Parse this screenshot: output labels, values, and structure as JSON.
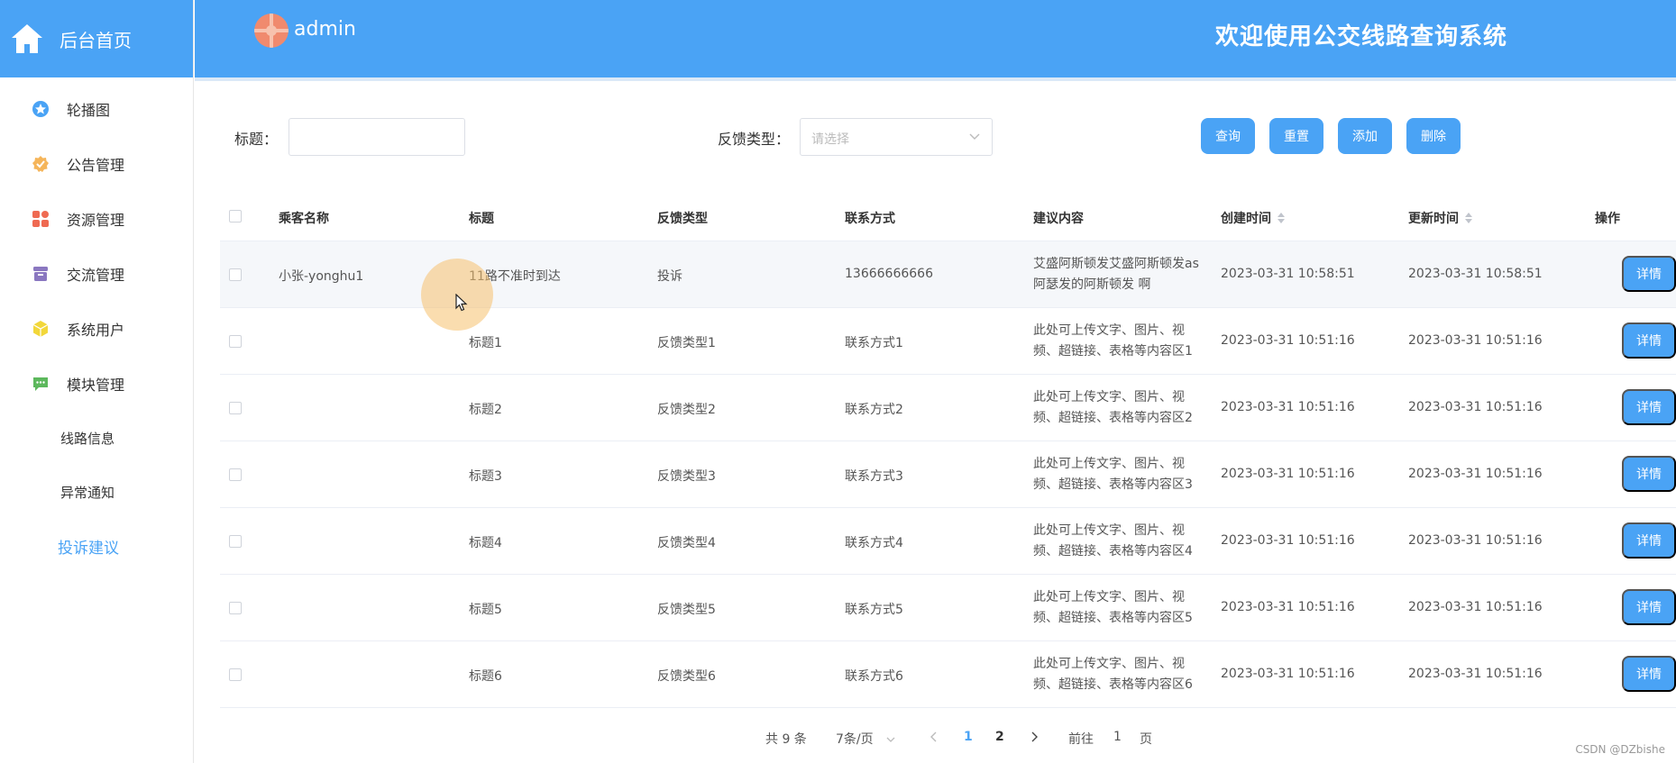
{
  "sidebar": {
    "home_label": "后台首页",
    "items": [
      {
        "label": "轮播图",
        "icon": "star-icon",
        "color": "#4aa3f5"
      },
      {
        "label": "公告管理",
        "icon": "badge-icon",
        "color": "#f5b55a"
      },
      {
        "label": "资源管理",
        "icon": "grid-icon",
        "color": "#ef6a52"
      },
      {
        "label": "交流管理",
        "icon": "archive-icon",
        "color": "#8a77c0"
      },
      {
        "label": "系统用户",
        "icon": "cube-icon",
        "color": "#f2d73a"
      },
      {
        "label": "模块管理",
        "icon": "chat-icon",
        "color": "#5cb85c"
      }
    ],
    "subitems": [
      {
        "label": "线路信息"
      },
      {
        "label": "异常通知"
      },
      {
        "label": "投诉建议"
      }
    ]
  },
  "header": {
    "user": "admin",
    "title": "欢迎使用公交线路查询系统"
  },
  "search": {
    "title_label": "标题：",
    "title_value": "",
    "type_label": "反馈类型：",
    "type_placeholder": "请选择",
    "buttons": {
      "query": "查询",
      "reset": "重置",
      "add": "添加",
      "delete": "删除"
    }
  },
  "table": {
    "headers": [
      "乘客名称",
      "标题",
      "反馈类型",
      "联系方式",
      "建议内容",
      "创建时间",
      "更新时间",
      "操作"
    ],
    "detail_label": "详情",
    "rows": [
      {
        "passenger": "小张-yonghu1",
        "title": "11路不准时到达",
        "type": "投诉",
        "contact": "13666666666",
        "content": "艾盛阿斯顿发艾盛阿斯顿发as阿瑟发的阿斯顿发 啊",
        "created": "2023-03-31 10:58:51",
        "updated": "2023-03-31 10:58:51"
      },
      {
        "passenger": "",
        "title": "标题1",
        "type": "反馈类型1",
        "contact": "联系方式1",
        "content": "此处可上传文字、图片、视频、超链接、表格等内容区1",
        "created": "2023-03-31 10:51:16",
        "updated": "2023-03-31 10:51:16"
      },
      {
        "passenger": "",
        "title": "标题2",
        "type": "反馈类型2",
        "contact": "联系方式2",
        "content": "此处可上传文字、图片、视频、超链接、表格等内容区2",
        "created": "2023-03-31 10:51:16",
        "updated": "2023-03-31 10:51:16"
      },
      {
        "passenger": "",
        "title": "标题3",
        "type": "反馈类型3",
        "contact": "联系方式3",
        "content": "此处可上传文字、图片、视频、超链接、表格等内容区3",
        "created": "2023-03-31 10:51:16",
        "updated": "2023-03-31 10:51:16"
      },
      {
        "passenger": "",
        "title": "标题4",
        "type": "反馈类型4",
        "contact": "联系方式4",
        "content": "此处可上传文字、图片、视频、超链接、表格等内容区4",
        "created": "2023-03-31 10:51:16",
        "updated": "2023-03-31 10:51:16"
      },
      {
        "passenger": "",
        "title": "标题5",
        "type": "反馈类型5",
        "contact": "联系方式5",
        "content": "此处可上传文字、图片、视频、超链接、表格等内容区5",
        "created": "2023-03-31 10:51:16",
        "updated": "2023-03-31 10:51:16"
      },
      {
        "passenger": "",
        "title": "标题6",
        "type": "反馈类型6",
        "contact": "联系方式6",
        "content": "此处可上传文字、图片、视频、超链接、表格等内容区6",
        "created": "2023-03-31 10:51:16",
        "updated": "2023-03-31 10:51:16"
      }
    ]
  },
  "pagination": {
    "total": "共 9 条",
    "page_size": "7条/页",
    "pages": [
      "1",
      "2"
    ],
    "goto_prefix": "前往",
    "goto_value": "1",
    "goto_suffix": "页"
  },
  "watermark": "CSDN @DZbishe",
  "colors": {
    "accent": "#4aa3f5"
  }
}
